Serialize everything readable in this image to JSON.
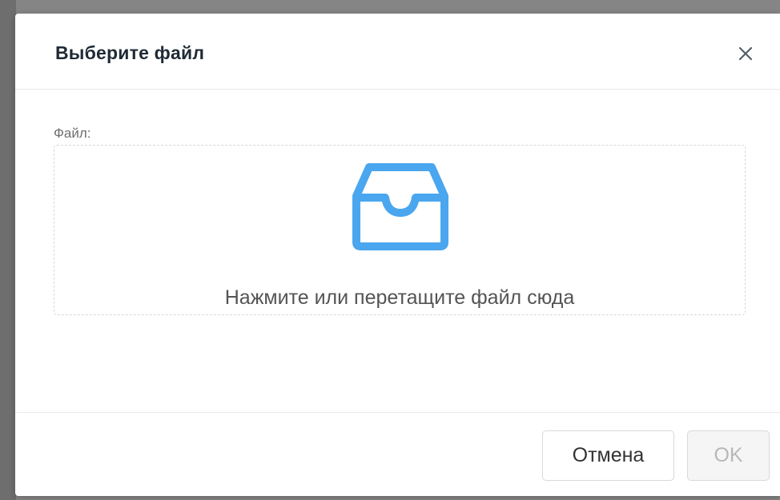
{
  "dialog": {
    "title": "Выберите файл",
    "close_icon": "close-icon"
  },
  "upload": {
    "field_label": "Файл:",
    "icon": "inbox-icon",
    "icon_color": "#4aa6ee",
    "hint": "Нажмите или перетащите файл сюда"
  },
  "footer": {
    "cancel_label": "Отмена",
    "ok_label": "OK",
    "ok_disabled": true
  }
}
